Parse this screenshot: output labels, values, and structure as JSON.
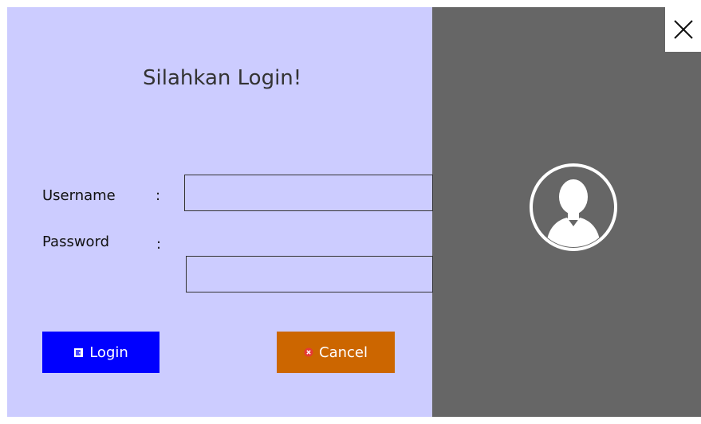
{
  "login_form": {
    "title": "Silahkan Login!",
    "username_label": "Username",
    "password_label": "Password",
    "colon": ":",
    "username_value": "",
    "password_value": "",
    "login_button": "Login",
    "cancel_button": "Cancel"
  },
  "icons": {
    "close": "close-icon",
    "login": "login-door-icon",
    "cancel": "cancel-x-icon",
    "avatar": "user-avatar-icon"
  },
  "colors": {
    "form_background": "#ccccff",
    "side_panel": "#666666",
    "login_button": "#0000ff",
    "cancel_button": "#cc6600",
    "cancel_icon": "#e53935"
  }
}
